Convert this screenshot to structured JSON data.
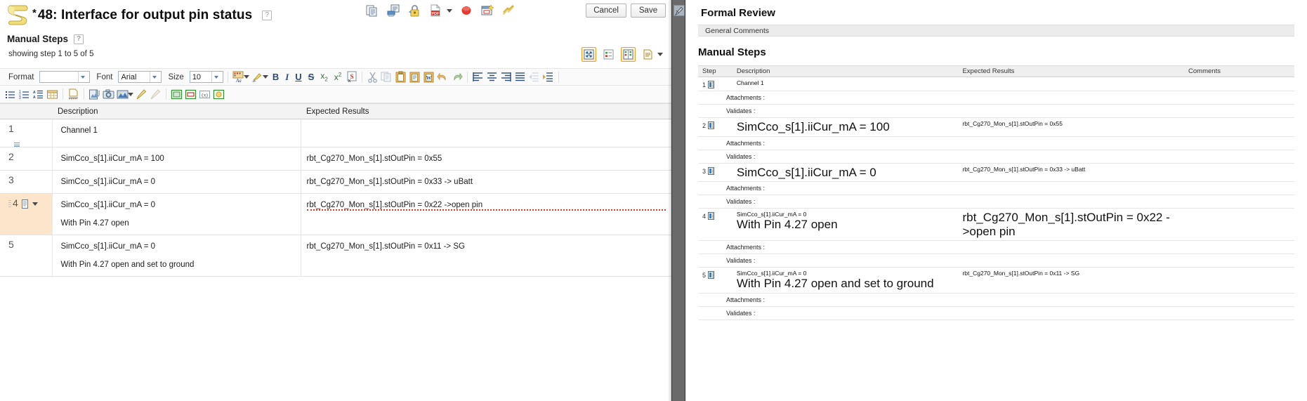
{
  "window": {
    "title_prefix": "*",
    "title": "48:  Interface for output pin status",
    "help_tooltip": "?",
    "cancel_label": "Cancel",
    "save_label": "Save"
  },
  "title_toolbar": {
    "icons": [
      {
        "name": "copy-icon",
        "label": "Copy"
      },
      {
        "name": "print-icon",
        "label": "Print"
      },
      {
        "name": "lock-icon",
        "label": "Lock"
      },
      {
        "name": "pdf-export-icon",
        "label": "Export PDF"
      },
      {
        "name": "pdf-dropdown-caret",
        "label": ""
      },
      {
        "name": "record-icon",
        "label": "Record"
      },
      {
        "name": "new-window-icon",
        "label": "New Window"
      },
      {
        "name": "link-icon",
        "label": "Link"
      }
    ]
  },
  "section": {
    "heading": "Manual Steps",
    "help_tooltip": "?",
    "showing": "showing step 1 to 5 of 5"
  },
  "view_buttons": [
    {
      "name": "expand-view-button",
      "active": true
    },
    {
      "name": "list-view-button",
      "active": false
    },
    {
      "name": "grid-view-button",
      "active": true
    },
    {
      "name": "print-view-button",
      "active": false
    },
    {
      "name": "print-view-caret",
      "active": false
    }
  ],
  "editor_toolbar": {
    "format_label": "Format",
    "format_value": "",
    "font_label": "Font",
    "font_value": "Arial",
    "size_label": "Size",
    "size_value": "10",
    "row1_icons": [
      {
        "name": "text-color-icon"
      },
      {
        "name": "text-color-caret"
      },
      {
        "name": "highlight-color-icon"
      },
      {
        "name": "highlight-color-caret"
      },
      {
        "name": "bold-icon",
        "glyph": "B"
      },
      {
        "name": "italic-icon",
        "glyph": "I"
      },
      {
        "name": "underline-icon",
        "glyph": "U"
      },
      {
        "name": "strikethrough-icon",
        "glyph": "S"
      },
      {
        "name": "subscript-icon",
        "glyph": "x"
      },
      {
        "name": "superscript-icon",
        "glyph": "x"
      },
      {
        "name": "remove-format-icon"
      },
      {
        "name": "cut-icon"
      },
      {
        "name": "copy-icon"
      },
      {
        "name": "paste-icon"
      },
      {
        "name": "paste-text-icon"
      },
      {
        "name": "paste-word-icon"
      },
      {
        "name": "undo-icon"
      },
      {
        "name": "redo-icon"
      },
      {
        "name": "align-left-icon"
      },
      {
        "name": "align-center-icon"
      },
      {
        "name": "align-right-icon"
      },
      {
        "name": "align-justify-icon"
      },
      {
        "name": "outdent-icon"
      },
      {
        "name": "indent-icon"
      }
    ],
    "row2_icons": [
      {
        "name": "bullet-list-icon"
      },
      {
        "name": "numbered-list-icon"
      },
      {
        "name": "blockquote-icon"
      },
      {
        "name": "insert-table-icon"
      },
      {
        "name": "page-break-icon"
      },
      {
        "name": "attach-file-icon"
      },
      {
        "name": "screenshot-icon"
      },
      {
        "name": "insert-image-icon"
      },
      {
        "name": "insert-image-caret"
      },
      {
        "name": "draw-icon"
      },
      {
        "name": "erase-icon"
      },
      {
        "name": "insert-parameter-icon"
      },
      {
        "name": "insert-field-icon"
      },
      {
        "name": "insert-variable-icon"
      },
      {
        "name": "insert-object-icon"
      }
    ]
  },
  "steps_table": {
    "columns": [
      "",
      "Description",
      "Expected Results"
    ],
    "rows": [
      {
        "num": "1",
        "selected": false,
        "description": [
          "Channel 1"
        ],
        "expected": []
      },
      {
        "num": "2",
        "selected": false,
        "description": [
          "SimCco_s[1].iiCur_mA = 100"
        ],
        "expected": [
          "rbt_Cg270_Mon_s[1].stOutPin = 0x55"
        ]
      },
      {
        "num": "3",
        "selected": false,
        "description": [
          "SimCco_s[1].iiCur_mA = 0"
        ],
        "expected": [
          "rbt_Cg270_Mon_s[1].stOutPin = 0x33 -> uBatt"
        ]
      },
      {
        "num": "4",
        "selected": true,
        "description": [
          "SimCco_s[1].iiCur_mA = 0",
          "With Pin 4.27 open"
        ],
        "expected": [
          "rbt_Cg270_Mon_s[1].stOutPin = 0x22 ->open pin"
        ]
      },
      {
        "num": "5",
        "selected": false,
        "description": [
          "SimCco_s[1].iiCur_mA = 0",
          "With Pin 4.27 open and set to ground"
        ],
        "expected": [
          "rbt_Cg270_Mon_s[1].stOutPin = 0x11 -> SG"
        ]
      }
    ]
  },
  "splitter": {
    "collapse_icon": "pen-edit-icon"
  },
  "review": {
    "title": "Formal Review",
    "general_comments_label": "General Comments",
    "subtitle": "Manual Steps",
    "columns": [
      "Step",
      "Description",
      "Expected Results",
      "Comments"
    ],
    "attachments_label": "Attachments :",
    "validates_label": "Validates :",
    "rows": [
      {
        "num": "1",
        "desc_small": "",
        "desc_big": "",
        "desc_plain": "Channel 1",
        "expected_small": "",
        "expected_big": "",
        "comments": ""
      },
      {
        "num": "2",
        "desc_small": "",
        "desc_big": "SimCco_s[1].iiCur_mA = 100",
        "desc_plain": "",
        "expected_small": "rbt_Cg270_Mon_s[1].stOutPin = 0x55",
        "expected_big": "",
        "comments": ""
      },
      {
        "num": "3",
        "desc_small": "",
        "desc_big": "SimCco_s[1].iiCur_mA = 0",
        "desc_plain": "",
        "expected_small": "rbt_Cg270_Mon_s[1].stOutPin = 0x33 -> uBatt",
        "expected_big": "",
        "comments": ""
      },
      {
        "num": "4",
        "desc_small": "SimCco_s[1].iiCur_mA = 0",
        "desc_big": "With Pin 4.27 open",
        "desc_plain": "",
        "expected_small": "",
        "expected_big": "rbt_Cg270_Mon_s[1].stOutPin = 0x22 ->open pin",
        "comments": ""
      },
      {
        "num": "5",
        "desc_small": "SimCco_s[1].iiCur_mA = 0",
        "desc_big": "With Pin 4.27 open and set to ground",
        "desc_plain": "",
        "expected_small": "rbt_Cg270_Mon_s[1].stOutPin = 0x11 -> SG",
        "expected_big": "",
        "comments": ""
      }
    ]
  },
  "colors": {
    "selection": "#fce5ca",
    "toolbar_bg": "#fafafa",
    "splitter": "#6a6a6a",
    "accent_orange": "#e0a33a"
  }
}
